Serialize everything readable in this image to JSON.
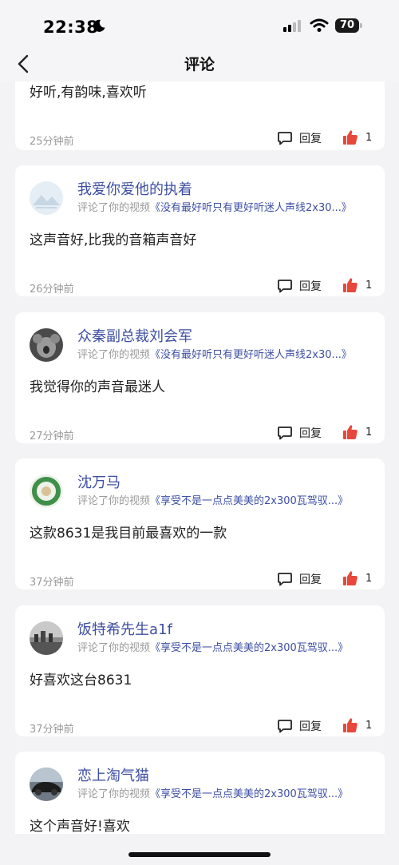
{
  "status": {
    "time": "22:38",
    "battery": "70"
  },
  "nav": {
    "title": "评论",
    "back_icon": "chevron-left-icon"
  },
  "colors": {
    "link": "#3d4fa3",
    "like": "#e8473b",
    "background": "#f3f3f5"
  },
  "reply_label": "回复",
  "comments": [
    {
      "time": "25分钟前",
      "content": "好听,有韵味,喜欢听",
      "likes": "1"
    },
    {
      "user": "我爱你爱他的执着",
      "action": "评论了你的视频",
      "video": "《没有最好听只有更好听迷人声线2x30...》",
      "content": "这声音好,比我的音箱声音好",
      "time": "26分钟前",
      "likes": "1"
    },
    {
      "user": "众秦副总裁刘会军",
      "action": "评论了你的视频",
      "video": "《没有最好听只有更好听迷人声线2x30...》",
      "content": "我觉得你的声音最迷人",
      "time": "27分钟前",
      "likes": "1"
    },
    {
      "user": "沈万马",
      "action": "评论了你的视频",
      "video": "《享受不是一点点美美的2x300瓦驾驭...》",
      "content": "这款8631是我目前最喜欢的一款",
      "time": "37分钟前",
      "likes": "1"
    },
    {
      "user": "饭特希先生a1f",
      "action": "评论了你的视频",
      "video": "《享受不是一点点美美的2x300瓦驾驭...》",
      "content": "好喜欢这台8631",
      "time": "37分钟前",
      "likes": "1"
    },
    {
      "user": "恋上淘气猫",
      "action": "评论了你的视频",
      "video": "《享受不是一点点美美的2x300瓦驾驭...》",
      "content": "这个声音好!喜欢"
    }
  ]
}
